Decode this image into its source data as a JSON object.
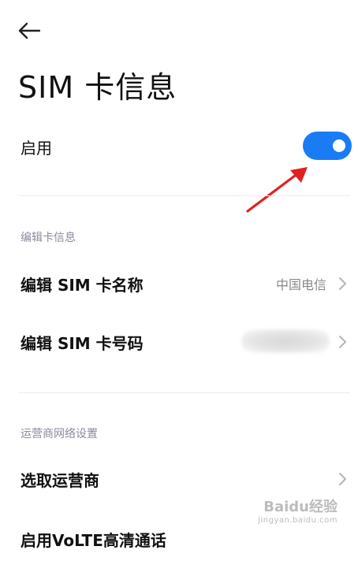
{
  "header": {
    "back_icon": "arrow-left-icon",
    "title": "SIM 卡信息"
  },
  "enable_row": {
    "label": "启用",
    "toggle_on": true,
    "toggle_color": "#1a7cf5"
  },
  "annotation": {
    "arrow_color": "#e02020"
  },
  "edit_section": {
    "header": "编辑卡信息",
    "items": [
      {
        "label": "编辑 SIM 卡名称",
        "value": "中国电信"
      },
      {
        "label": "编辑 SIM 卡号码",
        "value": ""
      }
    ]
  },
  "carrier_section": {
    "header": "运营商网络设置",
    "items": [
      {
        "label": "选取运营商"
      },
      {
        "label": "启用VoLTE高清通话"
      }
    ]
  },
  "watermark": {
    "brand": "Baidu经验",
    "sub": "jingyan.baidu.com"
  }
}
